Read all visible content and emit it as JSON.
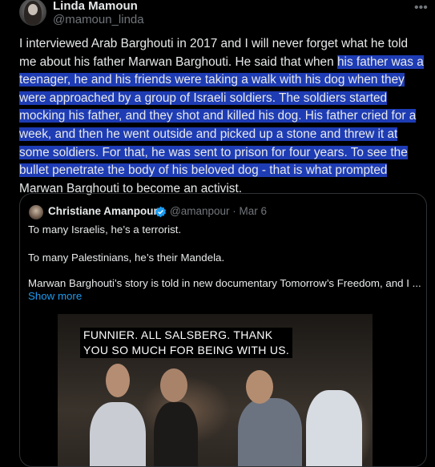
{
  "author": {
    "name": "Linda Mamoun",
    "handle": "@mamoun_linda"
  },
  "menu_icon": "more-horizontal-icon",
  "tweet": {
    "text_plain_start": "I interviewed Arab Barghouti in 2017 and I will never forget what he told me about his father Marwan Barghouti. He said that when ",
    "text_highlighted": "his father was a teenager, he and his friends were taking a walk with his dog when they were approached by a group of Israeli soldiers. The soldiers started mocking his father, and they shot and killed his dog. His father cried for a week, and then he went outside and picked up a stone and threw it at some soldiers. For that, he was sent to prison for four years. To see the bullet penetrate the body of his beloved dog - that is what prompted",
    "text_plain_end": " Marwan Barghouti to become an activist."
  },
  "quote": {
    "name": "Christiane Amanpour",
    "verified_icon": "verified-badge-icon",
    "handle_date": "@amanpour · Mar 6",
    "lines": [
      "To many Israelis, he’s a terrorist.",
      "To many Palestinians, he’s their Mandela.",
      "Marwan Barghouti’s story is told in new documentary Tomorrow’s Freedom, and I ..."
    ],
    "show_more": "Show more",
    "video": {
      "caption_line1": "FUNNIER. ALL SALSBERG. THANK",
      "caption_line2": "YOU SO MUCH FOR BEING WITH US."
    }
  },
  "colors": {
    "background": "#000000",
    "text": "#e7e9ea",
    "secondary": "#71767b",
    "link": "#1d9bf0",
    "selection": "#1e3cb4",
    "border": "#2f3336"
  }
}
